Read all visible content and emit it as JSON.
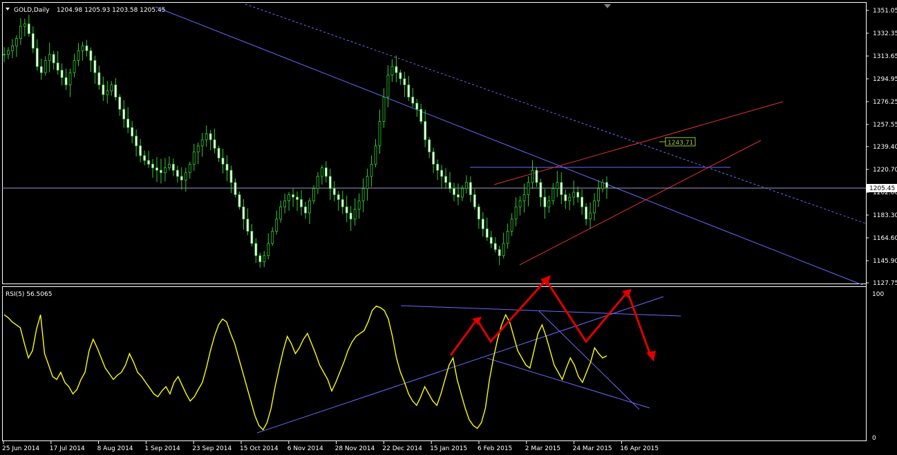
{
  "chart_data": [
    {
      "type": "candlestick",
      "symbol_label": "GOLD,Daily",
      "ohlc_label": "1204.98 1205.93 1203.58 1205.45",
      "price_axis_ticks": [
        "1351.05",
        "1332.35",
        "1313.65",
        "1294.95",
        "1276.25",
        "1257.55",
        "1239.40",
        "1220.70",
        "1202.00",
        "1183.30",
        "1164.60",
        "1145.90",
        "1127.75"
      ],
      "ylim": [
        1127.75,
        1351.05
      ],
      "current_price_label": "1205.45",
      "current_price": 1205.45,
      "annotation_label": "1243.71",
      "annotation_price": 1243.71,
      "date_axis_ticks": [
        "25 Jun 2014",
        "17 Jul 2014",
        "8 Aug 2014",
        "1 Sep 2014",
        "23 Sep 2014",
        "15 Oct 2014",
        "6 Nov 2014",
        "28 Nov 2014",
        "22 Dec 2014",
        "15 Jan 2015",
        "6 Feb 2015",
        "2 Mar 2015",
        "24 Mar 2015",
        "16 Apr 2015"
      ],
      "close_series": {
        "name": "",
        "values": [
          1315,
          1318,
          1322,
          1328,
          1338,
          1340,
          1332,
          1320,
          1305,
          1300,
          1310,
          1315,
          1308,
          1302,
          1296,
          1290,
          1300,
          1310,
          1318,
          1322,
          1318,
          1310,
          1300,
          1290,
          1282,
          1285,
          1290,
          1280,
          1270,
          1262,
          1255,
          1248,
          1240,
          1232,
          1228,
          1225,
          1222,
          1220,
          1218,
          1222,
          1225,
          1220,
          1215,
          1212,
          1218,
          1225,
          1235,
          1240,
          1245,
          1250,
          1245,
          1238,
          1230,
          1225,
          1220,
          1210,
          1200,
          1190,
          1180,
          1170,
          1160,
          1150,
          1145,
          1150,
          1160,
          1170,
          1180,
          1190,
          1195,
          1200,
          1198,
          1196,
          1190,
          1185,
          1195,
          1205,
          1215,
          1222,
          1215,
          1205,
          1200,
          1196,
          1190,
          1185,
          1180,
          1188,
          1195,
          1205,
          1215,
          1225,
          1240,
          1260,
          1280,
          1298,
          1305,
          1300,
          1295,
          1290,
          1280,
          1275,
          1270,
          1260,
          1245,
          1235,
          1225,
          1220,
          1215,
          1210,
          1205,
          1200,
          1198,
          1205,
          1210,
          1200,
          1190,
          1180,
          1172,
          1165,
          1160,
          1155,
          1150,
          1160,
          1170,
          1180,
          1190,
          1195,
          1200,
          1210,
          1220,
          1210,
          1198,
          1190,
          1195,
          1205,
          1210,
          1200,
          1195,
          1198,
          1202,
          1198,
          1190,
          1180,
          1185,
          1195,
          1205,
          1210,
          1206
        ]
      }
    },
    {
      "type": "line",
      "indicator_label": "RSI(5) 56.5065",
      "ylim": [
        0,
        100
      ],
      "axis_ticks": [
        "100",
        "0"
      ],
      "series": [
        {
          "name": "RSI(5)",
          "color": "#ffff00",
          "values": [
            85,
            83,
            80,
            78,
            76,
            65,
            55,
            60,
            75,
            85,
            58,
            50,
            42,
            40,
            45,
            38,
            35,
            30,
            33,
            40,
            45,
            60,
            68,
            62,
            55,
            48,
            44,
            40,
            43,
            45,
            50,
            58,
            52,
            45,
            42,
            38,
            34,
            30,
            28,
            32,
            35,
            30,
            38,
            42,
            36,
            30,
            25,
            28,
            33,
            38,
            48,
            60,
            70,
            78,
            82,
            80,
            72,
            65,
            55,
            45,
            35,
            25,
            15,
            8,
            5,
            10,
            20,
            35,
            48,
            60,
            70,
            65,
            58,
            62,
            68,
            72,
            65,
            58,
            50,
            45,
            40,
            32,
            38,
            45,
            52,
            60,
            66,
            70,
            72,
            74,
            80,
            88,
            91,
            90,
            88,
            82,
            70,
            55,
            45,
            38,
            30,
            25,
            22,
            28,
            35,
            30,
            25,
            22,
            30,
            40,
            50,
            55,
            40,
            30,
            20,
            12,
            8,
            6,
            10,
            20,
            40,
            55,
            68,
            78,
            85,
            80,
            70,
            60,
            55,
            50,
            48,
            60,
            72,
            78,
            70,
            60,
            50,
            45,
            40,
            48,
            55,
            50,
            42,
            38,
            45,
            52,
            62,
            58,
            55,
            56.5
          ]
        }
      ]
    }
  ]
}
